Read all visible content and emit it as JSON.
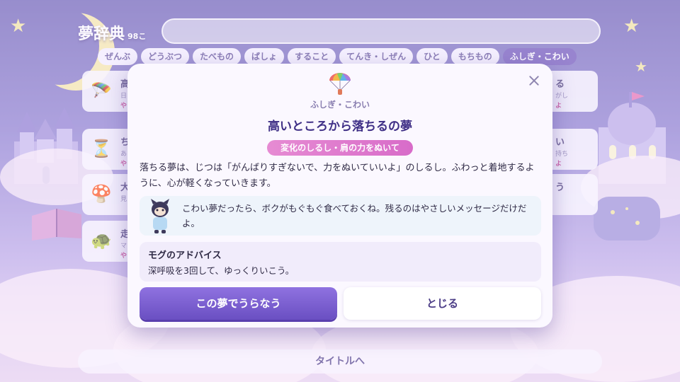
{
  "dictionary": {
    "title": "夢辞典",
    "count": "98こ",
    "categories": [
      {
        "label": "ぜんぶ"
      },
      {
        "label": "どうぶつ"
      },
      {
        "label": "たべもの"
      },
      {
        "label": "ばしょ"
      },
      {
        "label": "すること"
      },
      {
        "label": "てんき・しぜん"
      },
      {
        "label": "ひと"
      },
      {
        "label": "もちもの"
      },
      {
        "label": "ふしぎ・こわい"
      }
    ],
    "active_category": "ふしぎ・こわい",
    "title_button": "タイトルへ"
  },
  "cards": [
    {
      "title": "高",
      "sub": "日",
      "ribbon": "や",
      "icon": "parachute-icon"
    },
    {
      "title": "ち",
      "sub": "あ",
      "ribbon": "や",
      "icon": "hourglass-icon"
    },
    {
      "title": "大",
      "sub": "見",
      "ribbon": "",
      "icon": "mushroom-icon"
    },
    {
      "title": "走",
      "sub": "マ",
      "ribbon": "や",
      "icon": "turtle-icon"
    },
    {
      "title": "る",
      "sub": "がし",
      "ribbon": "よ",
      "icon": ""
    },
    {
      "title": "い",
      "sub": "持ち",
      "ribbon": "よ",
      "icon": ""
    },
    {
      "title": "う",
      "sub": "",
      "ribbon": "",
      "icon": ""
    }
  ],
  "modal": {
    "icon": "parachute-icon",
    "category": "ふしぎ・こわい",
    "title": "高いところから落ちるの夢",
    "badge": "変化のしるし・肩の力をぬいて",
    "description": "落ちる夢は、じつは「がんばりすぎないで、力をぬいていいよ」のしるし。ふわっと着地するように、心が軽くなっていきます。",
    "speech": "こわい夢だったら、ボクがもぐもぐ食べておくね。残るのはやさしいメッセージだけだよ。",
    "advice_heading": "モグのアドバイス",
    "advice_text": "深呼吸を3回して、ゆっくりいこう。",
    "primary_button": "この夢でうらなう",
    "secondary_button": "とじる"
  }
}
